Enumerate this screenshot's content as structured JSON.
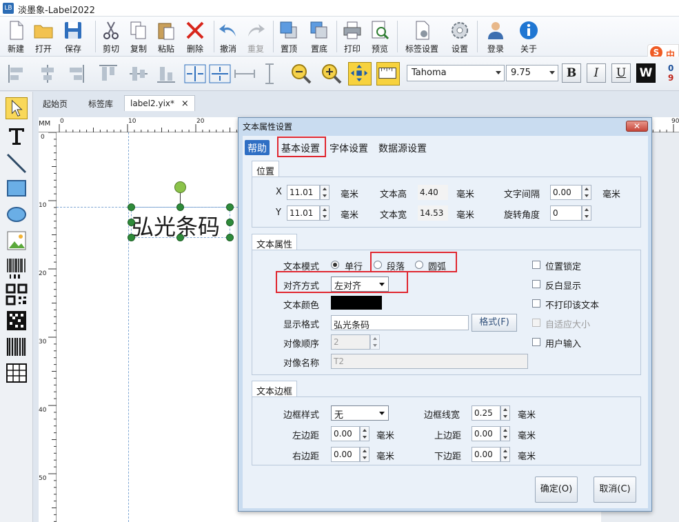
{
  "window": {
    "title": "淡墨象-Label2022",
    "icon_text": "LB"
  },
  "toolbar": [
    {
      "id": "new",
      "label": "新建"
    },
    {
      "id": "open",
      "label": "打开"
    },
    {
      "id": "save",
      "label": "保存"
    },
    {
      "id": "cut",
      "label": "剪切"
    },
    {
      "id": "copy",
      "label": "复制"
    },
    {
      "id": "paste",
      "label": "粘贴"
    },
    {
      "id": "delete",
      "label": "删除"
    },
    {
      "id": "undo",
      "label": "撤消"
    },
    {
      "id": "redo",
      "label": "重复"
    },
    {
      "id": "bring-front",
      "label": "置顶"
    },
    {
      "id": "send-back",
      "label": "置底"
    },
    {
      "id": "print",
      "label": "打印"
    },
    {
      "id": "preview",
      "label": "预览"
    },
    {
      "id": "label-settings",
      "label": "标签设置"
    },
    {
      "id": "settings",
      "label": "设置"
    },
    {
      "id": "login",
      "label": "登录"
    },
    {
      "id": "about",
      "label": "关于"
    }
  ],
  "ime": {
    "text": "中"
  },
  "format_bar": {
    "font": "Tahoma",
    "font_size": "9.75",
    "bold": "B",
    "italic": "I",
    "underline": "U",
    "reverse": "W",
    "counter_top": "0",
    "counter_bottom": "9"
  },
  "tabs": [
    {
      "label": "起始页",
      "active": false
    },
    {
      "label": "标签库",
      "active": false
    },
    {
      "label": "label2.yix*",
      "active": true,
      "close": "×"
    }
  ],
  "ruler": {
    "unit": "MM",
    "top": [
      "0",
      "10",
      "20"
    ],
    "top_right": "90",
    "left": [
      "0",
      "10",
      "20",
      "30",
      "40",
      "50"
    ]
  },
  "canvas": {
    "text_object": "弘光条码"
  },
  "dialog": {
    "title": "文本属性设置",
    "close": "✕",
    "tabs": [
      "帮助",
      "基本设置",
      "字体设置",
      "数据源设置"
    ],
    "position": {
      "title": "位置",
      "x_label": "X",
      "x_value": "11.01",
      "x_unit": "毫米",
      "y_label": "Y",
      "y_value": "11.01",
      "y_unit": "毫米",
      "height_label": "文本高",
      "height_value": "4.40",
      "height_unit": "毫米",
      "width_label": "文本宽",
      "width_value": "14.53",
      "width_unit": "毫米",
      "spacing_label": "文字间隔",
      "spacing_value": "0.00",
      "spacing_unit": "毫米",
      "rotation_label": "旋转角度",
      "rotation_value": "0"
    },
    "text_props": {
      "title": "文本属性",
      "mode_label": "文本模式",
      "mode_single": "单行",
      "mode_paragraph": "段落",
      "mode_arc": "圆弧",
      "align_label": "对齐方式",
      "align_value": "左对齐",
      "color_label": "文本颜色",
      "color_value": "#000000",
      "format_label": "显示格式",
      "format_value": "弘光条码",
      "format_button": "格式(F)",
      "order_label": "对像顺序",
      "order_value": "2",
      "name_label": "对像名称",
      "name_value": "T2",
      "lock": "位置锁定",
      "invert": "反白显示",
      "no_print": "不打印该文本",
      "autofit": "自适应大小",
      "user_input": "用户输入"
    },
    "border": {
      "title": "文本边框",
      "style_label": "边框样式",
      "style_value": "无",
      "width_label": "边框线宽",
      "width_value": "0.25",
      "width_unit": "毫米",
      "left_label": "左边距",
      "left_value": "0.00",
      "left_unit": "毫米",
      "top_label": "上边距",
      "top_value": "0.00",
      "top_unit": "毫米",
      "right_label": "右边距",
      "right_value": "0.00",
      "right_unit": "毫米",
      "bottom_label": "下边距",
      "bottom_value": "0.00",
      "bottom_unit": "毫米"
    },
    "ok": "确定(O)",
    "cancel": "取消(C)"
  }
}
